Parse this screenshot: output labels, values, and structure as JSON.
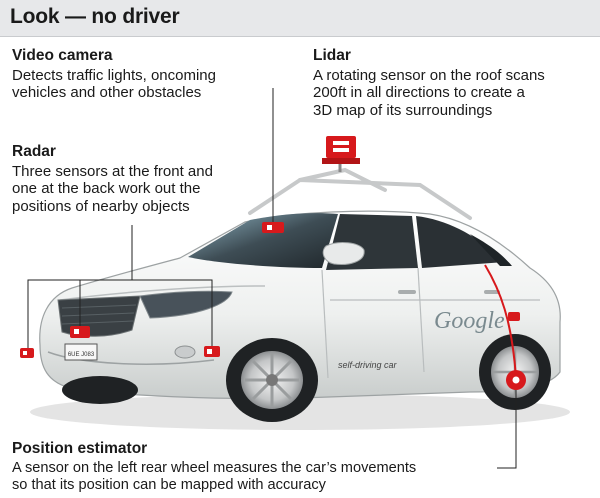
{
  "title": "Look — no driver",
  "callouts": {
    "video_camera": {
      "title": "Video camera",
      "desc": "Detects traffic lights, oncoming\nvehicles and other obstacles"
    },
    "lidar": {
      "title": "Lidar",
      "desc": "A rotating sensor on the roof scans\n200ft in all directions to create a\n3D map of its surroundings"
    },
    "radar": {
      "title": "Radar",
      "desc": "Three sensors at the front and\none at the back work out the\npositions of nearby objects"
    },
    "position_estimator": {
      "title": "Position estimator",
      "desc": "A sensor on the left rear wheel measures the car’s movements\nso that its position can be mapped with accuracy"
    }
  },
  "car": {
    "brand_logo": "Google",
    "door_text": "self-driving car",
    "license_plate": "6UE J083"
  },
  "colors": {
    "sensor_red": "#d7191c",
    "header_bg": "#e7e8ea",
    "car_body": "#eef0ef",
    "window": "#2b3236"
  }
}
